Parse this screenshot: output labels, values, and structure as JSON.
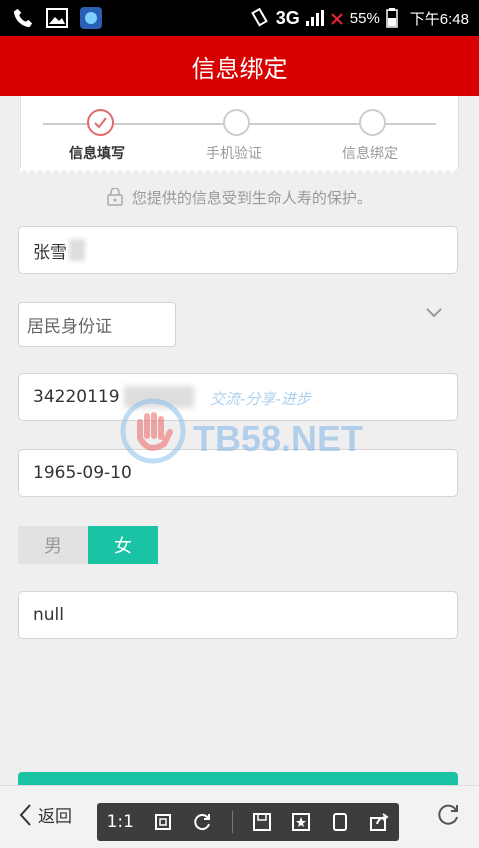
{
  "status_bar": {
    "network": "3G",
    "battery": "55%",
    "time": "下午6:48"
  },
  "header": {
    "title": "信息绑定"
  },
  "steps": [
    {
      "label": "信息填写",
      "active": true
    },
    {
      "label": "手机验证",
      "active": false
    },
    {
      "label": "信息绑定",
      "active": false
    }
  ],
  "protect_text": "您提供的信息受到生命人寿的保护。",
  "form": {
    "name_value": "张雪",
    "id_type": "居民身份证",
    "id_number": "34220119",
    "birthdate": "1965-09-10",
    "gender": {
      "male": "男",
      "female": "女",
      "selected": "女"
    },
    "extra_value": "null"
  },
  "bottom": {
    "back_label": "返回",
    "zoom_label": "1:1"
  },
  "watermark": {
    "site": "TB58.NET",
    "slogan": "交流-分享-进步"
  },
  "colors": {
    "header": "#d80000",
    "accent": "#1ac3a3"
  }
}
